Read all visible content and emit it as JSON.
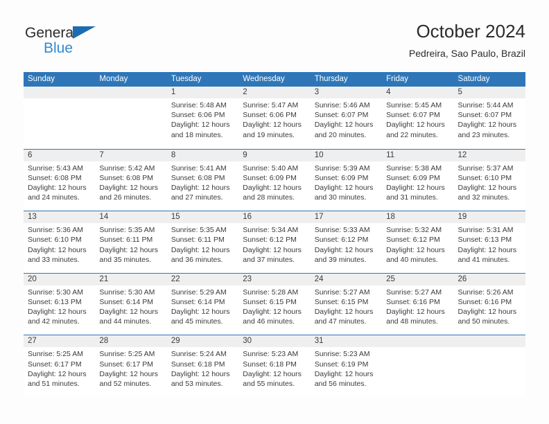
{
  "brand": {
    "name_top": "General",
    "name_bottom": "Blue",
    "triangle_icon": "brand-triangle-icon",
    "accent_dark_blue": "#1b6cb3",
    "accent_light_blue": "#2f8ad4"
  },
  "header": {
    "title": "October 2024",
    "subtitle": "Pedreira, Sao Paulo, Brazil"
  },
  "theme": {
    "header_blue": "#2e76b8",
    "day_band_gray": "#efefef",
    "text": "#3a3a3a",
    "page_bg": "#fdfdfd"
  },
  "weekdays": [
    "Sunday",
    "Monday",
    "Tuesday",
    "Wednesday",
    "Thursday",
    "Friday",
    "Saturday"
  ],
  "weeks": [
    [
      {
        "day": "",
        "lines": []
      },
      {
        "day": "",
        "lines": []
      },
      {
        "day": "1",
        "lines": [
          "Sunrise: 5:48 AM",
          "Sunset: 6:06 PM",
          "Daylight: 12 hours",
          "and 18 minutes."
        ]
      },
      {
        "day": "2",
        "lines": [
          "Sunrise: 5:47 AM",
          "Sunset: 6:06 PM",
          "Daylight: 12 hours",
          "and 19 minutes."
        ]
      },
      {
        "day": "3",
        "lines": [
          "Sunrise: 5:46 AM",
          "Sunset: 6:07 PM",
          "Daylight: 12 hours",
          "and 20 minutes."
        ]
      },
      {
        "day": "4",
        "lines": [
          "Sunrise: 5:45 AM",
          "Sunset: 6:07 PM",
          "Daylight: 12 hours",
          "and 22 minutes."
        ]
      },
      {
        "day": "5",
        "lines": [
          "Sunrise: 5:44 AM",
          "Sunset: 6:07 PM",
          "Daylight: 12 hours",
          "and 23 minutes."
        ]
      }
    ],
    [
      {
        "day": "6",
        "lines": [
          "Sunrise: 5:43 AM",
          "Sunset: 6:08 PM",
          "Daylight: 12 hours",
          "and 24 minutes."
        ]
      },
      {
        "day": "7",
        "lines": [
          "Sunrise: 5:42 AM",
          "Sunset: 6:08 PM",
          "Daylight: 12 hours",
          "and 26 minutes."
        ]
      },
      {
        "day": "8",
        "lines": [
          "Sunrise: 5:41 AM",
          "Sunset: 6:08 PM",
          "Daylight: 12 hours",
          "and 27 minutes."
        ]
      },
      {
        "day": "9",
        "lines": [
          "Sunrise: 5:40 AM",
          "Sunset: 6:09 PM",
          "Daylight: 12 hours",
          "and 28 minutes."
        ]
      },
      {
        "day": "10",
        "lines": [
          "Sunrise: 5:39 AM",
          "Sunset: 6:09 PM",
          "Daylight: 12 hours",
          "and 30 minutes."
        ]
      },
      {
        "day": "11",
        "lines": [
          "Sunrise: 5:38 AM",
          "Sunset: 6:09 PM",
          "Daylight: 12 hours",
          "and 31 minutes."
        ]
      },
      {
        "day": "12",
        "lines": [
          "Sunrise: 5:37 AM",
          "Sunset: 6:10 PM",
          "Daylight: 12 hours",
          "and 32 minutes."
        ]
      }
    ],
    [
      {
        "day": "13",
        "lines": [
          "Sunrise: 5:36 AM",
          "Sunset: 6:10 PM",
          "Daylight: 12 hours",
          "and 33 minutes."
        ]
      },
      {
        "day": "14",
        "lines": [
          "Sunrise: 5:35 AM",
          "Sunset: 6:11 PM",
          "Daylight: 12 hours",
          "and 35 minutes."
        ]
      },
      {
        "day": "15",
        "lines": [
          "Sunrise: 5:35 AM",
          "Sunset: 6:11 PM",
          "Daylight: 12 hours",
          "and 36 minutes."
        ]
      },
      {
        "day": "16",
        "lines": [
          "Sunrise: 5:34 AM",
          "Sunset: 6:12 PM",
          "Daylight: 12 hours",
          "and 37 minutes."
        ]
      },
      {
        "day": "17",
        "lines": [
          "Sunrise: 5:33 AM",
          "Sunset: 6:12 PM",
          "Daylight: 12 hours",
          "and 39 minutes."
        ]
      },
      {
        "day": "18",
        "lines": [
          "Sunrise: 5:32 AM",
          "Sunset: 6:12 PM",
          "Daylight: 12 hours",
          "and 40 minutes."
        ]
      },
      {
        "day": "19",
        "lines": [
          "Sunrise: 5:31 AM",
          "Sunset: 6:13 PM",
          "Daylight: 12 hours",
          "and 41 minutes."
        ]
      }
    ],
    [
      {
        "day": "20",
        "lines": [
          "Sunrise: 5:30 AM",
          "Sunset: 6:13 PM",
          "Daylight: 12 hours",
          "and 42 minutes."
        ]
      },
      {
        "day": "21",
        "lines": [
          "Sunrise: 5:30 AM",
          "Sunset: 6:14 PM",
          "Daylight: 12 hours",
          "and 44 minutes."
        ]
      },
      {
        "day": "22",
        "lines": [
          "Sunrise: 5:29 AM",
          "Sunset: 6:14 PM",
          "Daylight: 12 hours",
          "and 45 minutes."
        ]
      },
      {
        "day": "23",
        "lines": [
          "Sunrise: 5:28 AM",
          "Sunset: 6:15 PM",
          "Daylight: 12 hours",
          "and 46 minutes."
        ]
      },
      {
        "day": "24",
        "lines": [
          "Sunrise: 5:27 AM",
          "Sunset: 6:15 PM",
          "Daylight: 12 hours",
          "and 47 minutes."
        ]
      },
      {
        "day": "25",
        "lines": [
          "Sunrise: 5:27 AM",
          "Sunset: 6:16 PM",
          "Daylight: 12 hours",
          "and 48 minutes."
        ]
      },
      {
        "day": "26",
        "lines": [
          "Sunrise: 5:26 AM",
          "Sunset: 6:16 PM",
          "Daylight: 12 hours",
          "and 50 minutes."
        ]
      }
    ],
    [
      {
        "day": "27",
        "lines": [
          "Sunrise: 5:25 AM",
          "Sunset: 6:17 PM",
          "Daylight: 12 hours",
          "and 51 minutes."
        ]
      },
      {
        "day": "28",
        "lines": [
          "Sunrise: 5:25 AM",
          "Sunset: 6:17 PM",
          "Daylight: 12 hours",
          "and 52 minutes."
        ]
      },
      {
        "day": "29",
        "lines": [
          "Sunrise: 5:24 AM",
          "Sunset: 6:18 PM",
          "Daylight: 12 hours",
          "and 53 minutes."
        ]
      },
      {
        "day": "30",
        "lines": [
          "Sunrise: 5:23 AM",
          "Sunset: 6:18 PM",
          "Daylight: 12 hours",
          "and 55 minutes."
        ]
      },
      {
        "day": "31",
        "lines": [
          "Sunrise: 5:23 AM",
          "Sunset: 6:19 PM",
          "Daylight: 12 hours",
          "and 56 minutes."
        ]
      },
      {
        "day": "",
        "lines": []
      },
      {
        "day": "",
        "lines": []
      }
    ]
  ]
}
